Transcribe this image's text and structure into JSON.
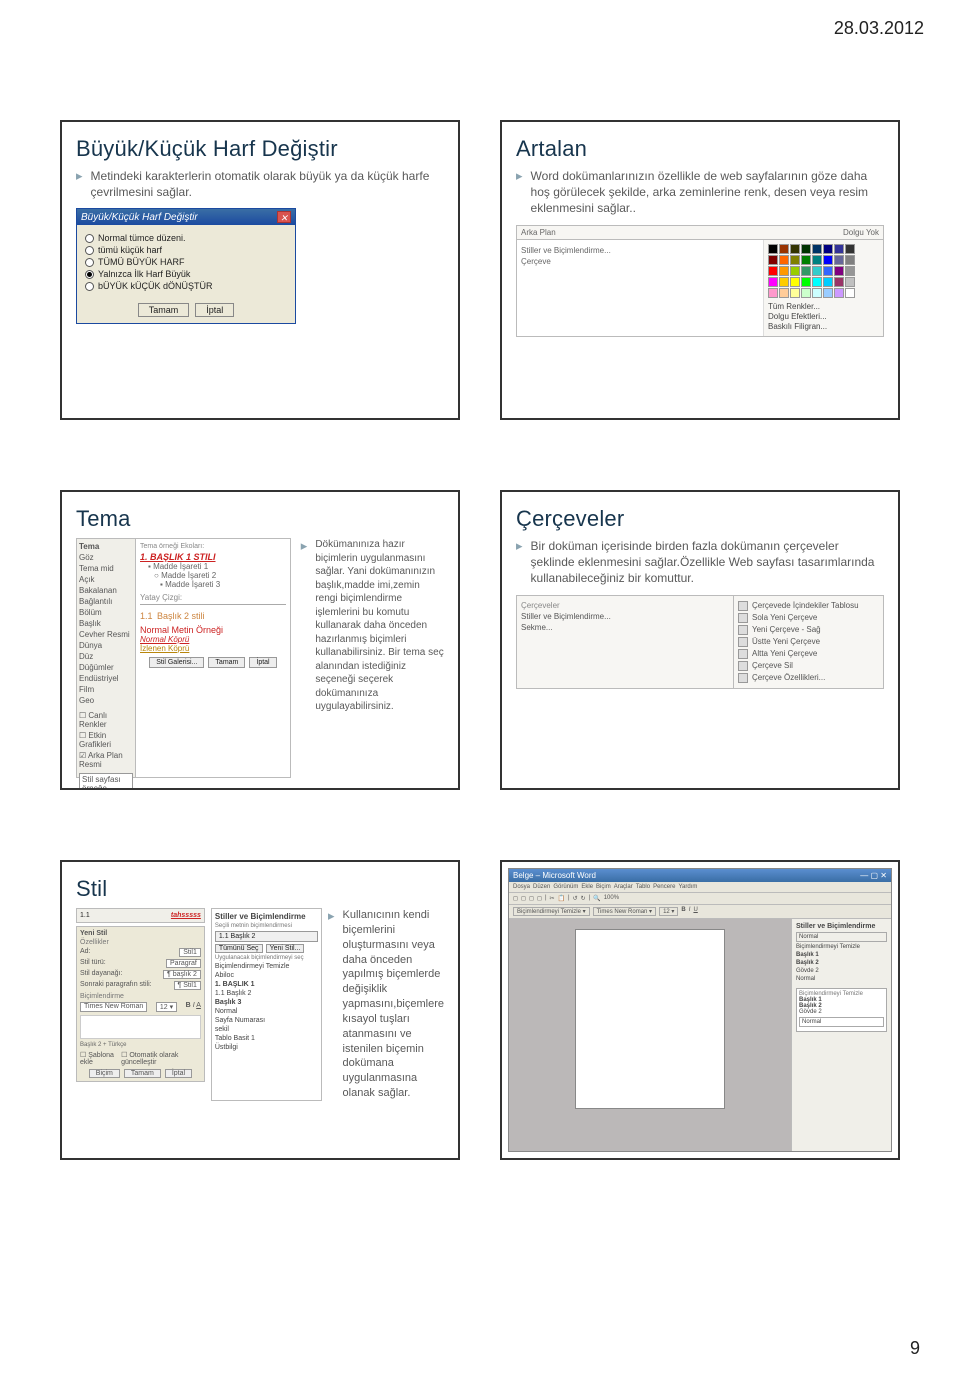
{
  "date": "28.03.2012",
  "page_number": "9",
  "slide1": {
    "title": "Büyük/Küçük Harf Değiştir",
    "bullet": "Metindeki karakterlerin otomatik olarak büyük ya da küçük harfe çevrilmesini sağlar.",
    "dialog_title": "Büyük/Küçük Harf Değiştir",
    "opt1": "Normal tümce düzeni.",
    "opt2": "tümü küçük harf",
    "opt3": "TÜMÜ BÜYÜK HARF",
    "opt4": "Yalnızca İlk Harf Büyük",
    "opt5": "bÜYÜK kÜÇÜK dÖNÜŞTÜR",
    "btn_ok": "Tamam",
    "btn_cancel": "İptal"
  },
  "slide2": {
    "title": "Artalan",
    "bullet": "Word dokümanlarınızın özellikle de web sayfalarının göze daha hoş görülecek şekilde, arka zeminlerine renk, desen veya resim eklenmesini sağlar..",
    "menu_group": "Arka Plan",
    "nofill": "Dolgu Yok",
    "m1": "Stiller ve Biçimlendirme...",
    "m2": "Çerçeve",
    "extra1": "Tüm Renkler...",
    "extra2": "Dolgu Efektleri...",
    "extra3": "Baskılı Filigran..."
  },
  "slide3": {
    "title": "Tema",
    "bullet": "Dökümanınıza hazır biçimlerin uygulanmasını sağlar. Yani dokümanınızın başlık,madde imi,zemin rengi biçimlendirme işlemlerini bu komutu kullanarak daha önceden hazırlanmış biçimleri kullanabilirsiniz. Bir tema seç alanından istediğiniz seçeneği seçerek dokümanınıza uygulayabilirsiniz.",
    "panel_hdr": "Tema",
    "heading1": "1. BAŞLIK 1 STILI",
    "li1": "Madde İşareti 1",
    "li2": "Madde İşareti 2",
    "li3": "Madde İşareti 3",
    "hline": "Yatay Çizgi:",
    "heading2_num": "1.1",
    "heading2": "Başlık 2 stili",
    "normal": "Normal Metin Örneği",
    "link1": "Normal Köprü",
    "link2": "İzlenen Köprü",
    "btn1": "Stil Galerisi...",
    "btn2": "Tamam",
    "btn3": "İptal"
  },
  "slide4": {
    "title": "Çerçeveler",
    "bullet": "Bir doküman içerisinde birden fazla dokümanın çerçeveler şeklinde eklenmesini sağlar.Özellikle Web sayfası tasarımlarında kullanabileceğiniz bir komuttur.",
    "left_hdr": "Çerçeveler",
    "l1": "Stiller ve Biçimlendirme...",
    "l2": "Sekme...",
    "r1": "Çerçevede İçindekiler Tablosu",
    "r2": "Sola Yeni Çerçeve",
    "r3": "Yeni Çerçeve - Sağ",
    "r4": "Üstte Yeni Çerçeve",
    "r5": "Altta Yeni Çerçeve",
    "r6": "Çerçeve Sil",
    "r7": "Çerçeve Özellikleri..."
  },
  "slide5": {
    "title": "Stil",
    "bullet": "Kullanıcının kendi biçemlerini oluşturmasını veya daha önceden yapılmış biçemlerde değişiklik yapmasını,biçemlere kısayol tuşları atanmasını ve istenilen biçemin dokümana uygulanmasına olanak sağlar.",
    "top_num": "1.1",
    "top_style": "tahsssss",
    "new_style": "Yeni Stil",
    "prop_hdr": "Özellikler",
    "f_ad": "Ad:",
    "f_tur": "Stil türü:",
    "f_temel": "Stil dayanağı:",
    "f_sonraki": "Sonraki paragrafın stili:",
    "v_tur": "Paragraf",
    "v_temel": "¶ başlık 2",
    "v_sonraki": "¶ Stil1",
    "fmt_hdr": "Biçimlendirme",
    "fmt_font": "Times New Roman",
    "chk1": "Şablona ekle",
    "chk2": "Otomatik olarak güncelleştir",
    "btn_format": "Biçim",
    "btn_ok": "Tamam",
    "btn_cancel": "İptal",
    "rnote": "Başlık 2 + Türkçe",
    "midhdr": "Stiller ve Biçimlendirme",
    "mid_sel_label": "Seçili metnin biçimlendirmesi",
    "mid_sel": "1.1 Başlık 2",
    "mid_b1": "Tümünü Seç",
    "mid_b2": "Yeni Stil...",
    "mid_applied": "Uygulanacak biçimlendirmeyi seç",
    "mid_sub": "Biçimlendirmeyi Temizle",
    "mid_abiloc": "Abiloc",
    "m_l1": "1. BAŞLIK 1",
    "m_l2": "1.1 Başlık 2",
    "m_l3": "Başlık 3",
    "m_l4": "Normal",
    "m_l5": "Sayfa Numarası",
    "m_l6": "sekil",
    "m_l7": "Tablo Basit 1",
    "m_l8": "Üstbilgi"
  },
  "slide6": {
    "wtitle": "Belge – Microsoft Word",
    "pane_hdr": "Stiller ve Biçimlendirme",
    "p_clear": "Biçimlendirmeyi Temizle",
    "p1": "Başlık 1",
    "p2": "Başlık 2",
    "p3": "Gövde 2",
    "p4": "Normal",
    "p_box_hdr": "Biçimlendirmeyi Temizle",
    "pb1": "Başlık 1",
    "pb2": "Başlık 2",
    "pb3": "Gövde 2",
    "pb_normal": "Normal"
  }
}
